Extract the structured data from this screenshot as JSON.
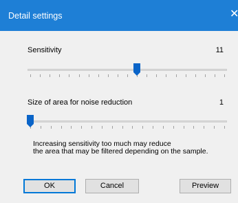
{
  "window": {
    "title": "Detail settings",
    "close_glyph": "✕"
  },
  "sensitivity": {
    "label": "Sensitivity",
    "value": "11",
    "min": 0,
    "max": 20,
    "level": 11
  },
  "noise_area": {
    "label": "Size of area for noise reduction",
    "value": "1",
    "min": 1,
    "max": 20,
    "level": 1
  },
  "note": {
    "line1": "Increasing sensitivity too much may reduce",
    "line2": "the area that may be filtered depending on the sample."
  },
  "buttons": {
    "ok": "OK",
    "cancel": "Cancel",
    "preview": "Preview"
  },
  "colors": {
    "title_bar": "#1e7fd6",
    "thumb": "#0a64c8",
    "dialog_bg": "#f0f0f0"
  }
}
